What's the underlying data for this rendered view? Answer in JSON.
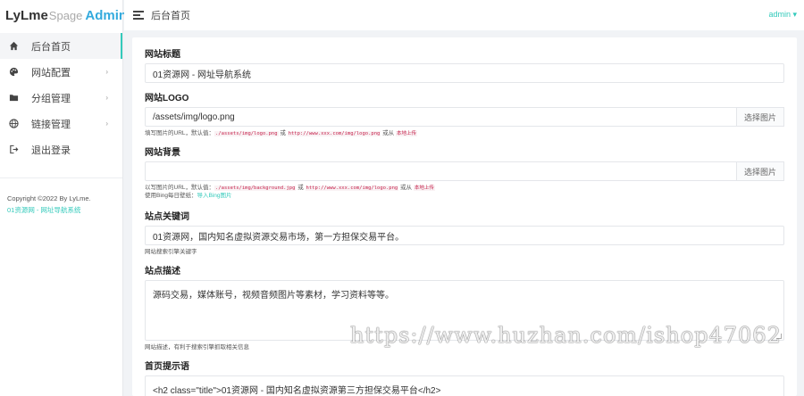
{
  "brand": {
    "part1": "LyLme",
    "part2": "Spage",
    "part3": "Admin"
  },
  "sidebar": {
    "items": [
      {
        "label": "后台首页",
        "icon": "home-icon"
      },
      {
        "label": "网站配置",
        "icon": "palette-icon"
      },
      {
        "label": "分组管理",
        "icon": "folder-icon"
      },
      {
        "label": "链接管理",
        "icon": "globe-icon"
      },
      {
        "label": "退出登录",
        "icon": "logout-icon"
      }
    ],
    "copyright_line1": "Copyright ©2022 By LyLme.",
    "copyright_line2": "01资源网 - 网址导航系统"
  },
  "topbar": {
    "title": "后台首页",
    "user": "admin ▾"
  },
  "form": {
    "site_title": {
      "label": "网站标题",
      "value": "01资源网 - 网址导航系统"
    },
    "site_logo": {
      "label": "网站LOGO",
      "value": "/assets/img/logo.png",
      "button": "选择图片",
      "help_pre": "填写图片的URL，默认值：",
      "help_code1": "./assets/img/logo.png",
      "help_mid": " 或 ",
      "help_code2": "http://www.xxx.com/img/logo.png",
      "help_post": " 或从 ",
      "help_code3": "本地上传"
    },
    "site_bg": {
      "label": "网站背景",
      "value": "",
      "button": "选择图片",
      "help_pre": "以写图片的URL，默认值：",
      "help_code1": "./assets/img/background.jpg",
      "help_mid": " 或 ",
      "help_code2": "http://www.xxx.com/img/logo.png",
      "help_post": " 或从 ",
      "help_code3": "本地上传",
      "help2_pre": "使用Bing每日壁纸：",
      "help2_link": "导入Bing图片"
    },
    "keywords": {
      "label": "站点关键词",
      "value": "01资源网，国内知名虚拟资源交易市场，第一方担保交易平台。",
      "help": "网站搜索引擎关键字"
    },
    "description": {
      "label": "站点描述",
      "value": "源码交易，媒体账号，视频音频图片等素材，学习资料等等。",
      "help": "网站描述，有利于搜索引擎抓取相关信息"
    },
    "home_tip": {
      "label": "首页提示语",
      "value": "<h2 class=\"title\">01资源网 - 国内知名虚拟资源第三方担保交易平台</h2>"
    }
  },
  "watermark": "https://www.huzhan.com/ishop47062"
}
